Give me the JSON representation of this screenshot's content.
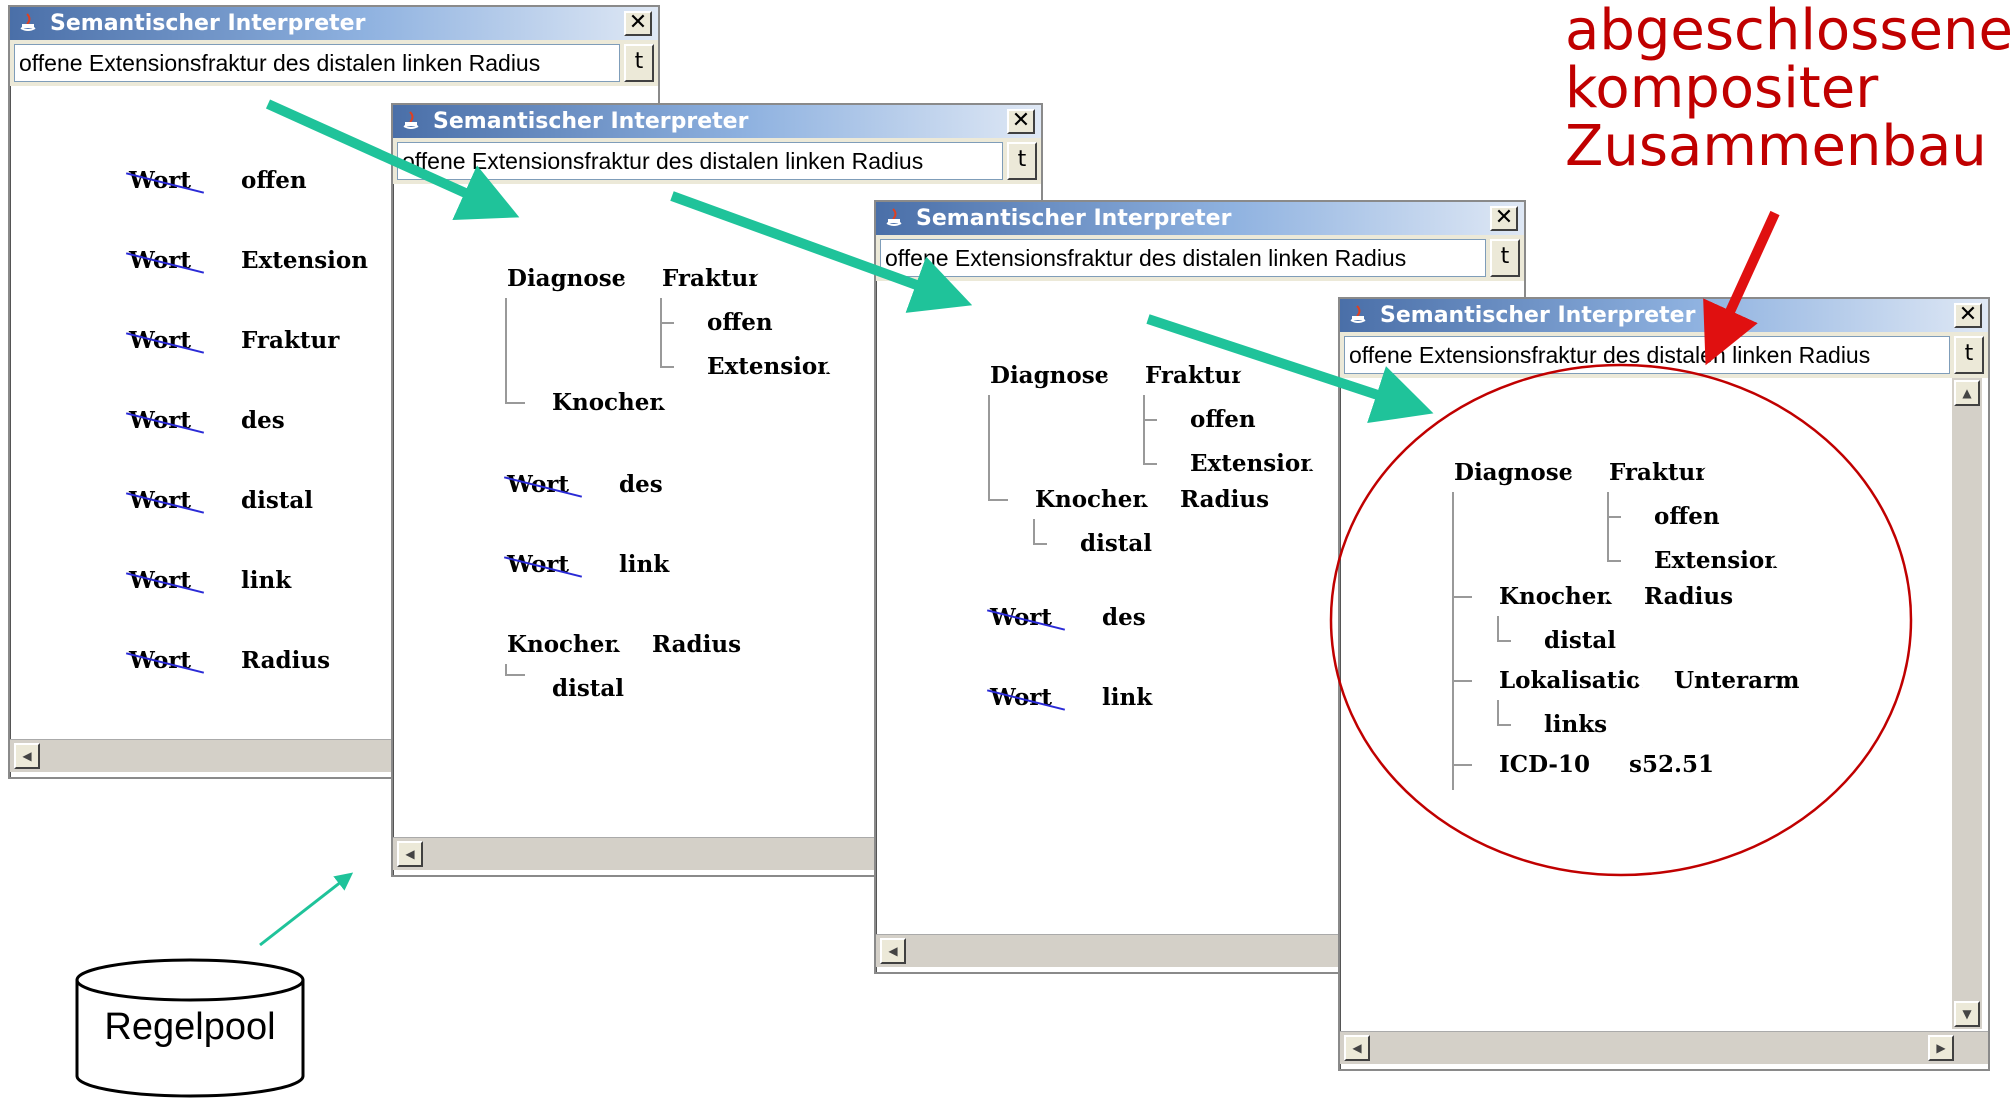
{
  "window_title": "Semantischer Interpreter",
  "input_text": "offene Extensionsfraktur des distalen linken Radius",
  "t_button": "t",
  "close_glyph": "✕",
  "annotation": {
    "line1": "abgeschlossener",
    "line2": "kompositer",
    "line3": "Zusammenbau"
  },
  "regelpool": "Regelpool",
  "wort": "Wort",
  "win1": {
    "words": [
      "offen",
      "Extension",
      "Fraktur",
      "des",
      "distal",
      "link",
      "Radius"
    ]
  },
  "win2": {
    "diagnose": "Diagnose",
    "fraktur": "Fraktur",
    "offen": "offen",
    "extension": "Extension",
    "knochen": "Knochen",
    "wort_des": "des",
    "wort_link": "link",
    "knochen2": "Knochen",
    "radius": "Radius",
    "distal": "distal"
  },
  "win3": {
    "diagnose": "Diagnose",
    "fraktur": "Fraktur",
    "offen": "offen",
    "extension": "Extension",
    "knochen": "Knochen",
    "radius": "Radius",
    "distal": "distal",
    "wort_des": "des",
    "wort_link": "link"
  },
  "win4": {
    "diagnose": "Diagnose",
    "fraktur": "Fraktur",
    "offen": "offen",
    "extension": "Extension",
    "knochen": "Knochen",
    "radius": "Radius",
    "distal": "distal",
    "lokalisation": "Lokalisation",
    "unterarm": "Unterarm",
    "links": "links",
    "icd": "ICD-10",
    "code": "s52.51"
  },
  "colors": {
    "arrow": "#1fc39a",
    "red": "#c00000",
    "titlebar": "#4a6fa8"
  }
}
